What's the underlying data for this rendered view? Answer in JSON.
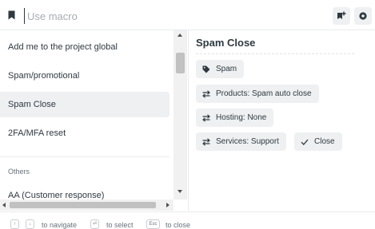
{
  "search": {
    "placeholder": "Use macro"
  },
  "toolbar": {
    "add_icon": "add-macro-icon",
    "settings_icon": "gear-icon"
  },
  "macros": {
    "items": [
      {
        "label": "Add me to the project global"
      },
      {
        "label": "Spam/promotional"
      },
      {
        "label": "Spam Close",
        "selected": true
      },
      {
        "label": "2FA/MFA reset"
      }
    ],
    "group_label": "Others",
    "group_items": [
      {
        "label": "AA (Customer response)"
      }
    ]
  },
  "preview": {
    "title": "Spam Close",
    "actions": [
      {
        "icon": "tag-icon",
        "label": "Spam"
      },
      {
        "icon": "swap-icon",
        "label": "Products: Spam auto close"
      },
      {
        "icon": "swap-icon",
        "label": "Hosting: None"
      },
      {
        "icon": "swap-icon",
        "label": "Services: Support"
      },
      {
        "icon": "check-icon",
        "label": "Close"
      }
    ]
  },
  "footer": {
    "navigate_keys": [
      "↑",
      "↓"
    ],
    "navigate_label": "to navigate",
    "select_key": "⏎",
    "select_label": "to select",
    "close_key": "Esc",
    "close_label": "to close"
  },
  "colors": {
    "text": "#2f3941",
    "muted": "#68737d",
    "selected_bg": "#eef0f2",
    "chip_bg": "#eef0f1"
  }
}
